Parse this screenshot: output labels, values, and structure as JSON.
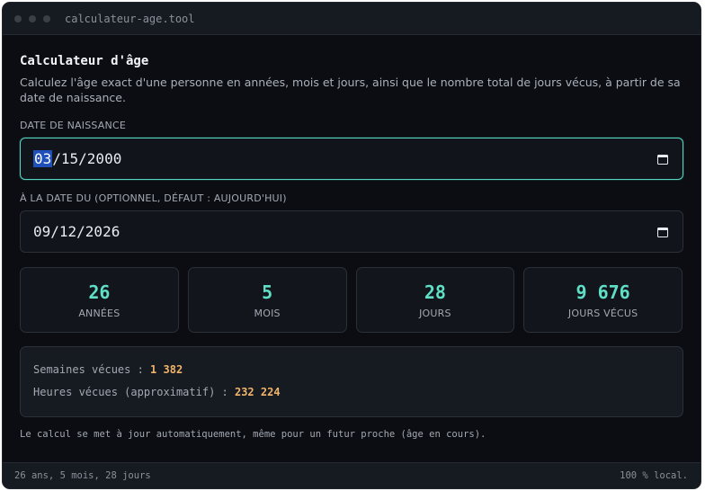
{
  "window": {
    "title": "calculateur-age.tool"
  },
  "header": {
    "title": "Calculateur d'âge",
    "description": "Calculez l'âge exact d'une personne en années, mois et jours, ainsi que le nombre total de jours vécus, à partir de sa date de naissance."
  },
  "birth_date": {
    "label": "DATE DE NAISSANCE",
    "month": "03",
    "rest": "/15/2000"
  },
  "ref_date": {
    "label": "À LA DATE DU (OPTIONNEL, DÉFAUT : AUJOURD'HUI)",
    "value": "09/12/2026"
  },
  "stats": [
    {
      "value": "26",
      "label": "ANNÉES"
    },
    {
      "value": "5",
      "label": "MOIS"
    },
    {
      "value": "28",
      "label": "JOURS"
    },
    {
      "value": "9 676",
      "label": "JOURS VÉCUS"
    }
  ],
  "details": {
    "weeks_label": "Semaines vécues : ",
    "weeks_value": "1 382",
    "hours_label": "Heures vécues (approximatif) : ",
    "hours_value": "232 224"
  },
  "note": "Le calcul se met à jour automatiquement, même pour un futur proche (âge en cours).",
  "status": {
    "left": "26 ans, 5 mois, 28 jours",
    "right": "100 % local."
  },
  "colors": {
    "accent": "#5fe0c6",
    "highlight": "#f2b46a",
    "background": "#0b0d12"
  }
}
